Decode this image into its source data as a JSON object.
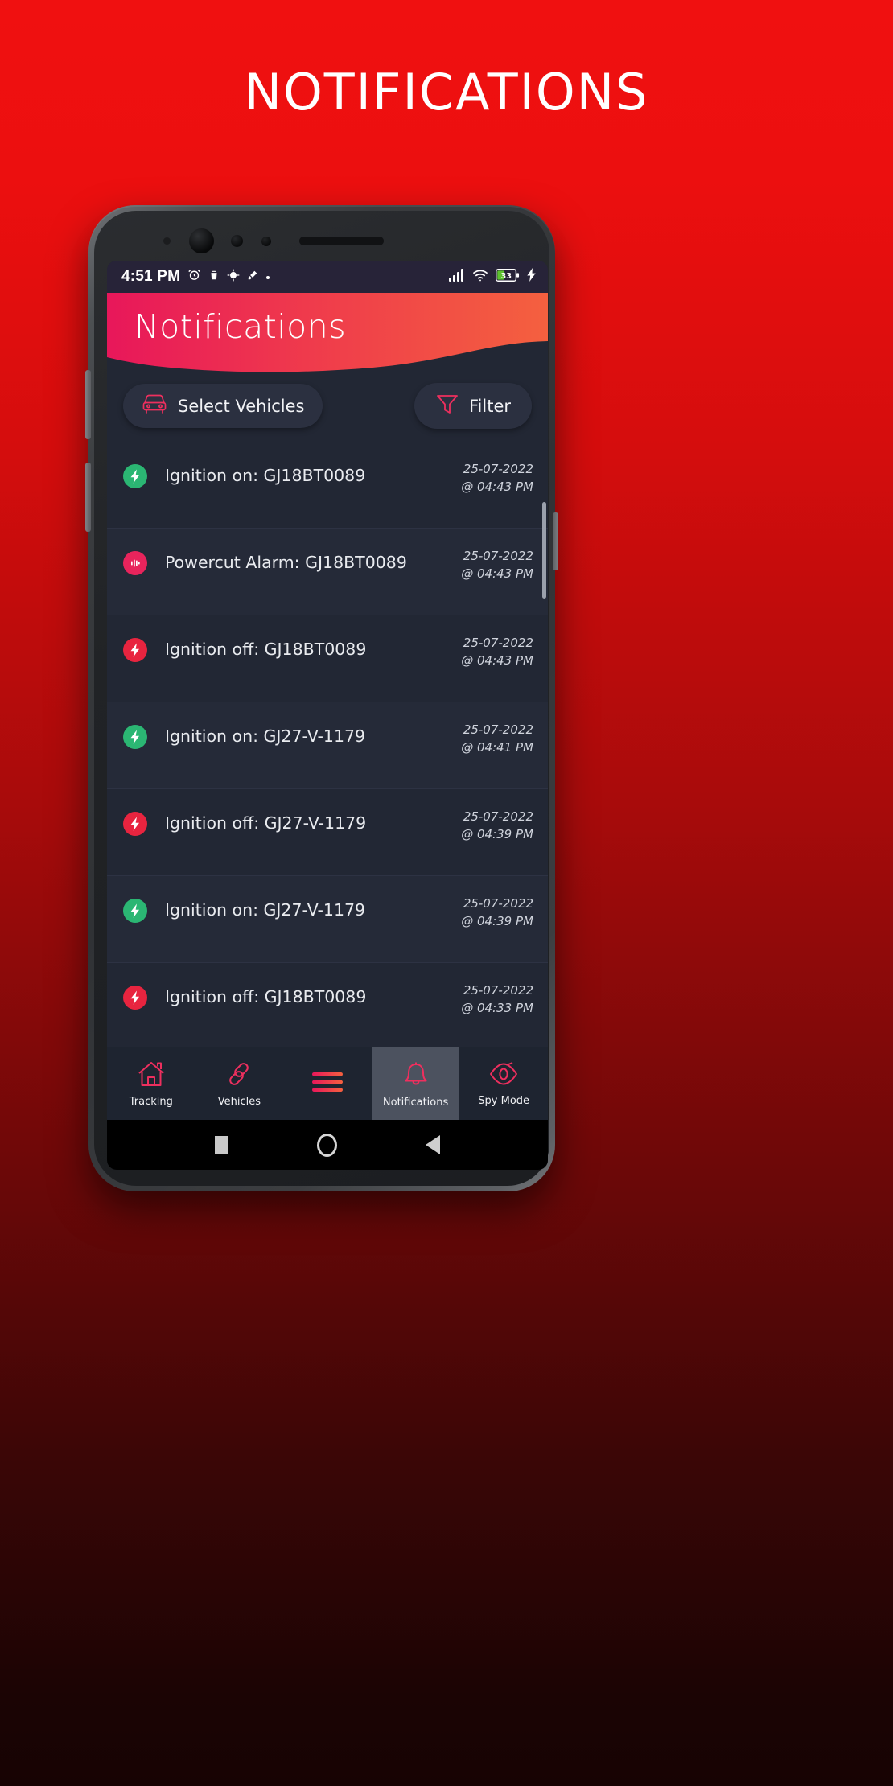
{
  "page": {
    "headline": "NOTIFICATIONS"
  },
  "status_bar": {
    "time": "4:51 PM",
    "left_icons": [
      "alarm-icon",
      "trash-icon",
      "location-icon",
      "eraser-icon",
      "dot-icon"
    ],
    "signal": "signal-bars-icon",
    "wifi": "wifi-icon",
    "battery_level": "33",
    "battery_charging": true
  },
  "app": {
    "title": "Notifications",
    "header_gradient_from": "#e8175a",
    "header_gradient_to": "#f4603f"
  },
  "toolbar": {
    "select_vehicles_label": "Select Vehicles",
    "filter_label": "Filter"
  },
  "notifications": [
    {
      "type": "ignition-on",
      "text": "Ignition on: GJ18BT0089",
      "date": "25-07-2022",
      "time": "@ 04:43 PM",
      "color": "#2bb673"
    },
    {
      "type": "powercut-alarm",
      "text": "Powercut Alarm: GJ18BT0089",
      "date": "25-07-2022",
      "time": "@ 04:43 PM",
      "color": "#e8245c"
    },
    {
      "type": "ignition-off",
      "text": "Ignition off: GJ18BT0089",
      "date": "25-07-2022",
      "time": "@ 04:43 PM",
      "color": "#e8243f"
    },
    {
      "type": "ignition-on",
      "text": "Ignition on: GJ27-V-1179",
      "date": "25-07-2022",
      "time": "@ 04:41 PM",
      "color": "#2bb673"
    },
    {
      "type": "ignition-off",
      "text": "Ignition off: GJ27-V-1179",
      "date": "25-07-2022",
      "time": "@ 04:39 PM",
      "color": "#e8243f"
    },
    {
      "type": "ignition-on",
      "text": "Ignition on: GJ27-V-1179",
      "date": "25-07-2022",
      "time": "@ 04:39 PM",
      "color": "#2bb673"
    },
    {
      "type": "ignition-off",
      "text": "Ignition off: GJ18BT0089",
      "date": "25-07-2022",
      "time": "@ 04:33 PM",
      "color": "#e8243f"
    }
  ],
  "bottom_nav": [
    {
      "icon": "home-icon",
      "label": "Tracking",
      "active": false
    },
    {
      "icon": "link-icon",
      "label": "Vehicles",
      "active": false
    },
    {
      "icon": "hamburger-icon",
      "label": "",
      "active": false
    },
    {
      "icon": "bell-icon",
      "label": "Notifications",
      "active": true
    },
    {
      "icon": "eye-icon",
      "label": "Spy Mode",
      "active": false
    }
  ],
  "system_nav": {
    "recents": "square-icon",
    "home": "circle-icon",
    "back": "triangle-back-icon"
  }
}
